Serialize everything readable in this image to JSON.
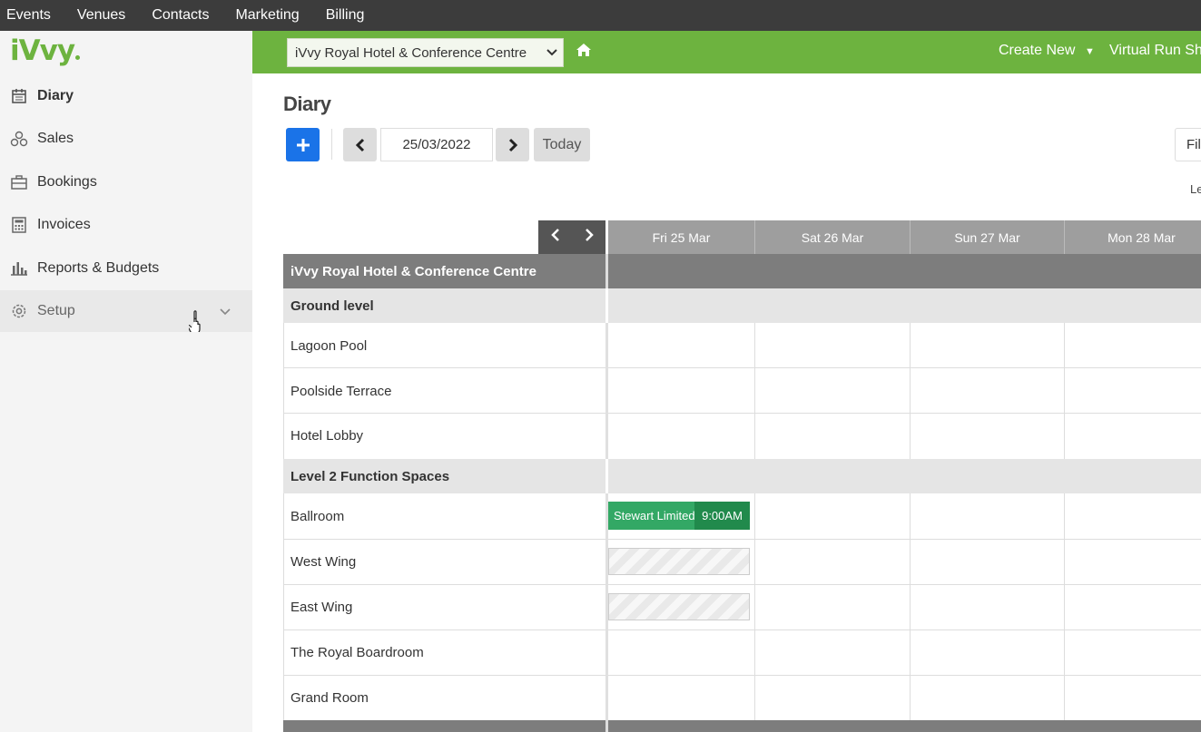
{
  "topnav": [
    "Events",
    "Venues",
    "Contacts",
    "Marketing",
    "Billing"
  ],
  "brand": "iVvy",
  "sidebar": {
    "items": [
      {
        "label": "Diary",
        "icon": "calendar-icon"
      },
      {
        "label": "Sales",
        "icon": "sales-icon"
      },
      {
        "label": "Bookings",
        "icon": "briefcase-icon"
      },
      {
        "label": "Invoices",
        "icon": "calculator-icon"
      },
      {
        "label": "Reports & Budgets",
        "icon": "bar-chart-icon"
      },
      {
        "label": "Setup",
        "icon": "gear-icon"
      }
    ]
  },
  "header": {
    "venue": "iVvy Royal Hotel & Conference Centre",
    "create_new": "Create New",
    "virtual_run": "Virtual Run Sh"
  },
  "toolbar": {
    "title": "Diary",
    "date": "25/03/2022",
    "today": "Today",
    "filter": "Fil",
    "legend": "Le"
  },
  "grid": {
    "days": [
      "Fri 25 Mar",
      "Sat 26 Mar",
      "Sun 27 Mar",
      "Mon 28 Mar"
    ],
    "venue": "iVvy Royal Hotel & Conference Centre",
    "levels": [
      "Ground level",
      "Level 2 Function Spaces"
    ],
    "rooms": [
      "Lagoon Pool",
      "Poolside Terrace",
      "Hotel Lobby",
      "Ballroom",
      "West Wing",
      "East Wing",
      "The Royal Boardroom",
      "Grand Room"
    ]
  },
  "booking": {
    "client": "Stewart Limited",
    "time": "9:00AM",
    "color": "#2e9e5b"
  },
  "colors": {
    "accent": "#6db33f",
    "primary_button": "#1a73e8"
  }
}
